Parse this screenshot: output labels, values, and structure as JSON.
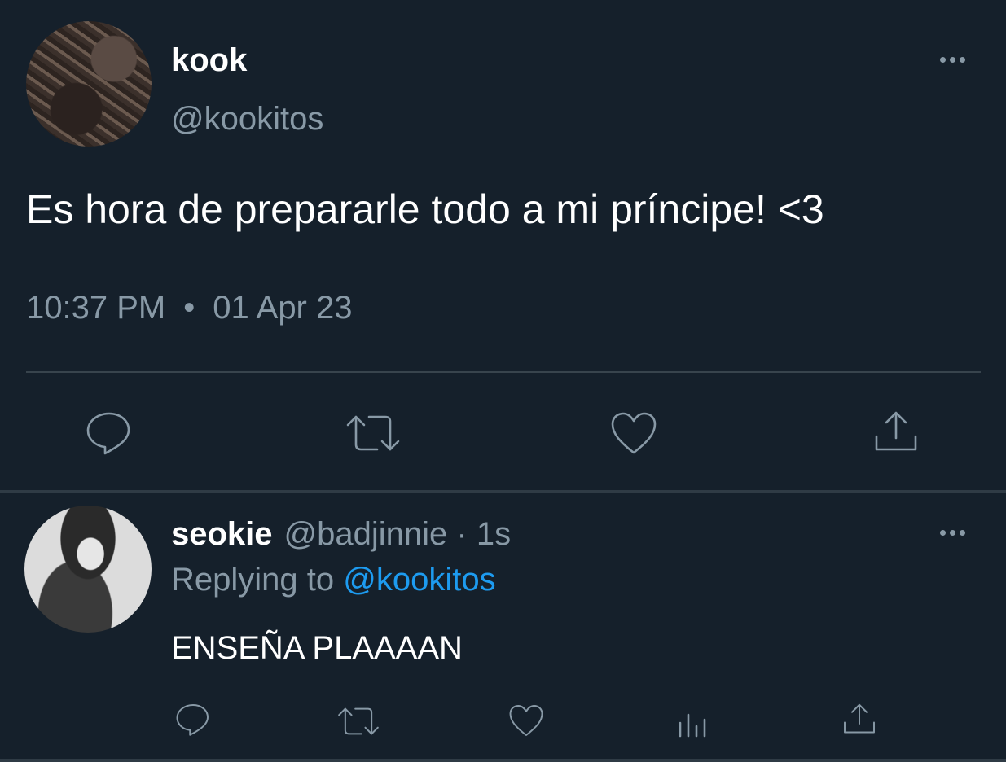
{
  "main_tweet": {
    "display_name": "kook",
    "handle": "@kookitos",
    "text": "Es hora de prepararle todo a mi príncipe! <3",
    "time": "10:37 PM",
    "separator": "•",
    "date": "01 Apr 23",
    "actions": [
      "reply-icon",
      "retweet-icon",
      "like-icon",
      "share-icon"
    ]
  },
  "reply_tweet": {
    "display_name": "seokie",
    "handle_time": "@badjinnie · 1s",
    "replying_prefix": "Replying to ",
    "replying_to": "@kookitos",
    "text": "ENSEÑA PLAAAAN",
    "actions": [
      "reply-icon",
      "retweet-icon",
      "like-icon",
      "analytics-icon",
      "share-icon"
    ]
  },
  "colors": {
    "background": "#15202b",
    "secondary_text": "#8899a6",
    "link": "#1d9bf0",
    "divider": "#38444d"
  }
}
